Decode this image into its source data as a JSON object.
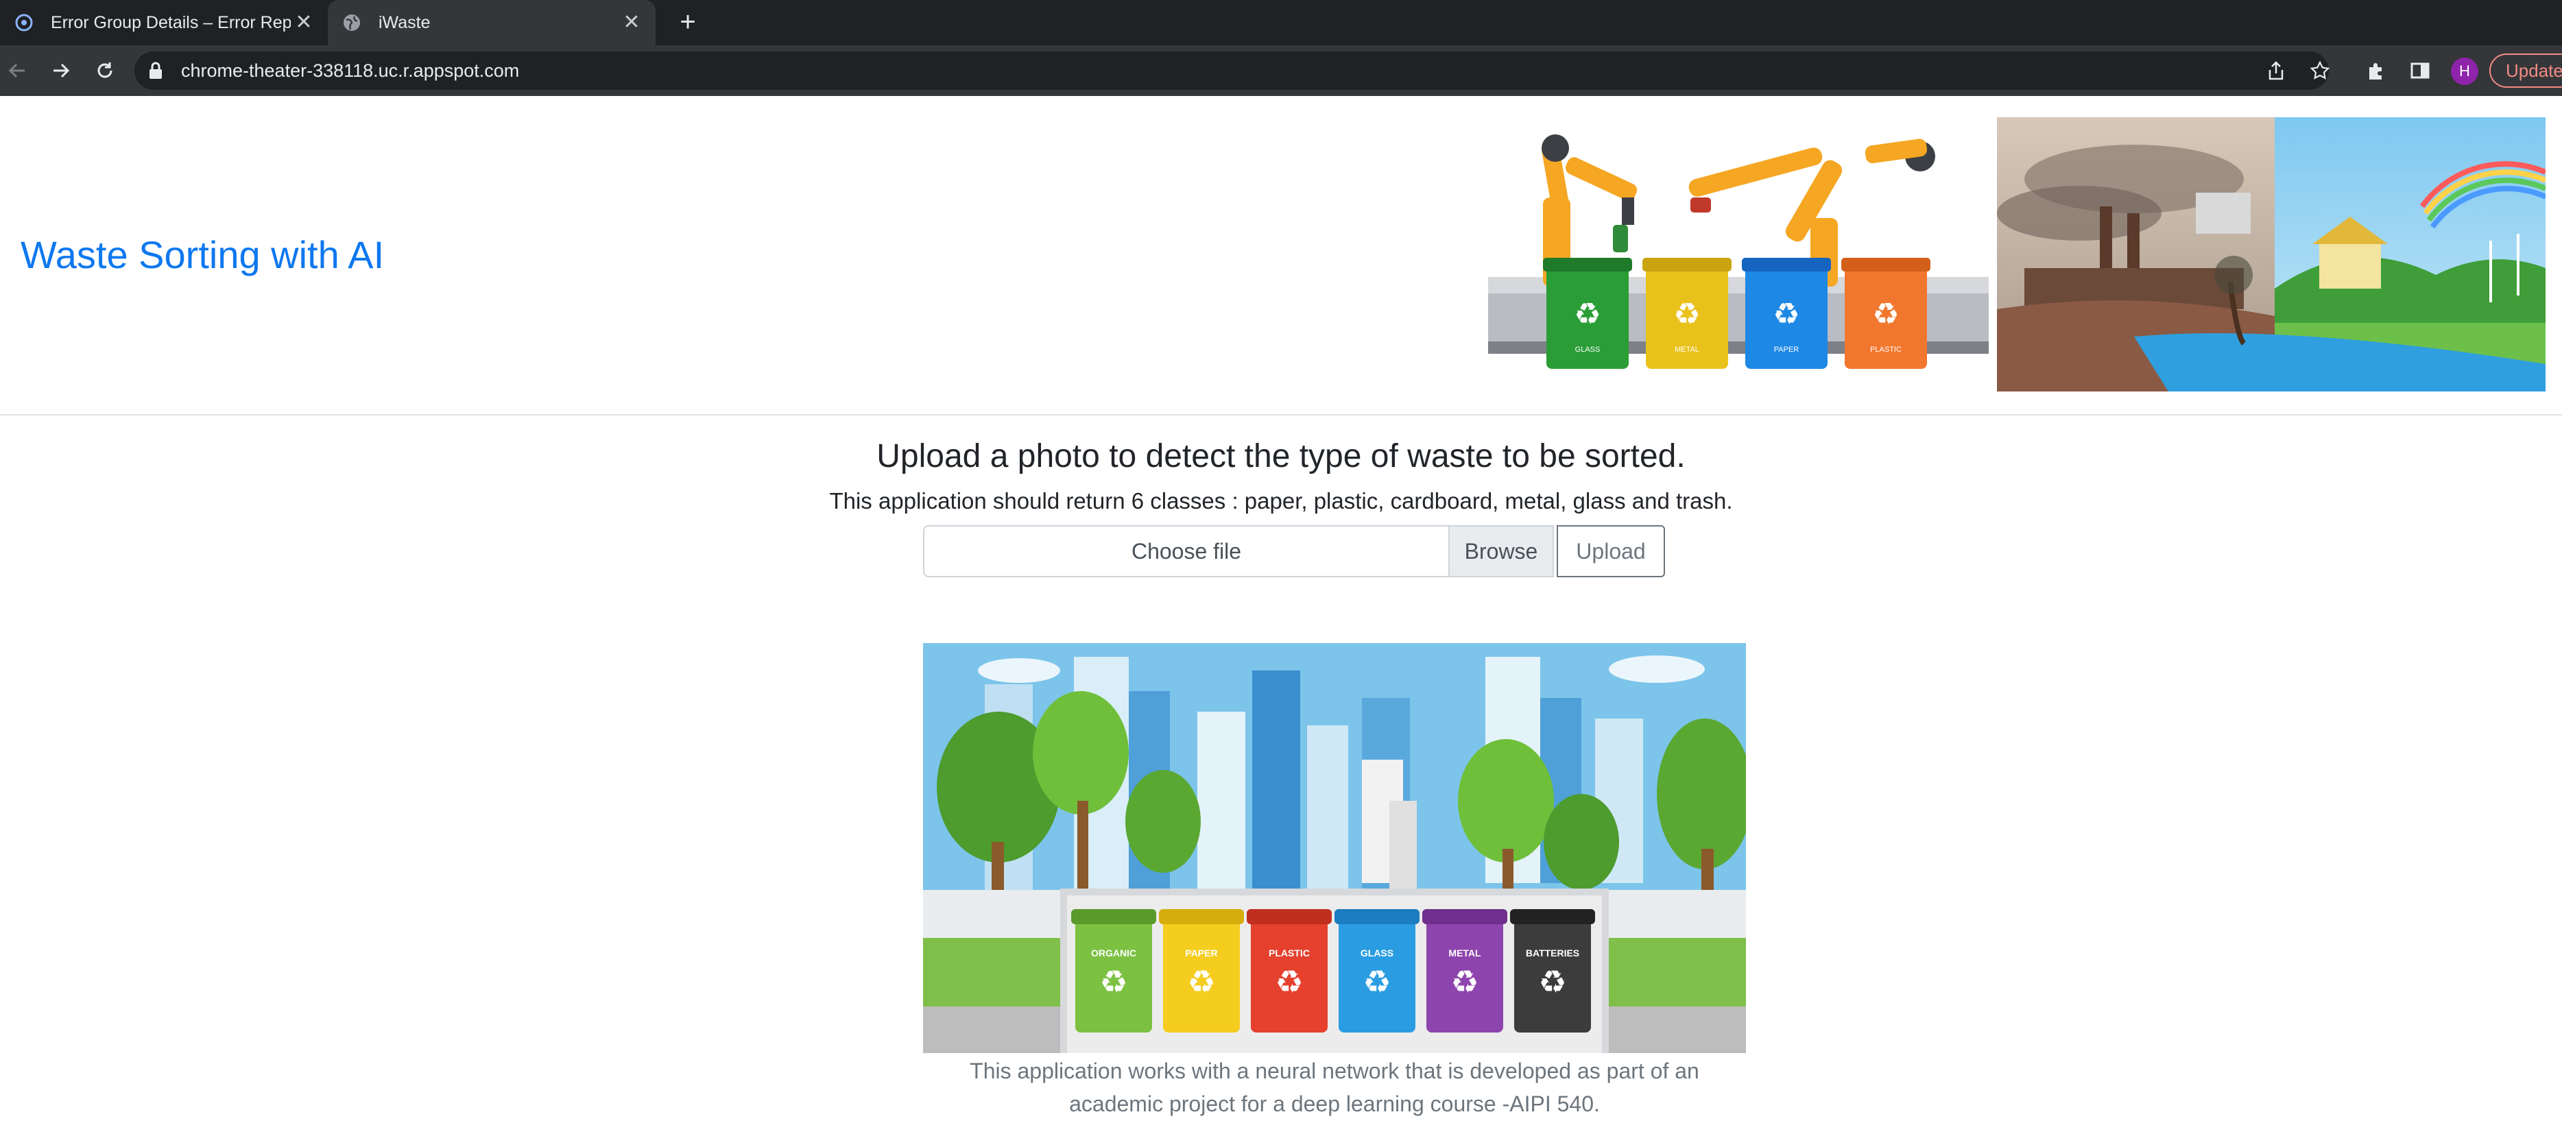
{
  "browser": {
    "tabs": [
      {
        "title": "Error Group Details – Error Rep",
        "active": false
      },
      {
        "title": "iWaste",
        "active": true
      }
    ],
    "url": "chrome-theater-338118.uc.r.appspot.com",
    "profile_initial": "H",
    "update_label": "Update"
  },
  "header": {
    "brand": "Waste Sorting with AI",
    "robot_bins": [
      "GLASS",
      "METAL",
      "PAPER",
      "PLASTIC"
    ]
  },
  "main": {
    "title": "Upload a photo to detect the type of waste to be sorted.",
    "subtitle": "This application should return 6 classes : paper, plastic, cardboard, metal, glass and trash.",
    "file_placeholder": "Choose file",
    "browse_label": "Browse",
    "upload_label": "Upload",
    "bins": [
      "ORGANIC",
      "PAPER",
      "PLASTIC",
      "GLASS",
      "METAL",
      "BATTERIES"
    ],
    "caption_line1": "This application works with a neural network that is developed as part of an",
    "caption_line2": "academic project for a deep learning course -AIPI 540."
  },
  "colors": {
    "brand": "#0d78ef",
    "chrome_dark": "#202124",
    "chrome_tab": "#35363a"
  }
}
